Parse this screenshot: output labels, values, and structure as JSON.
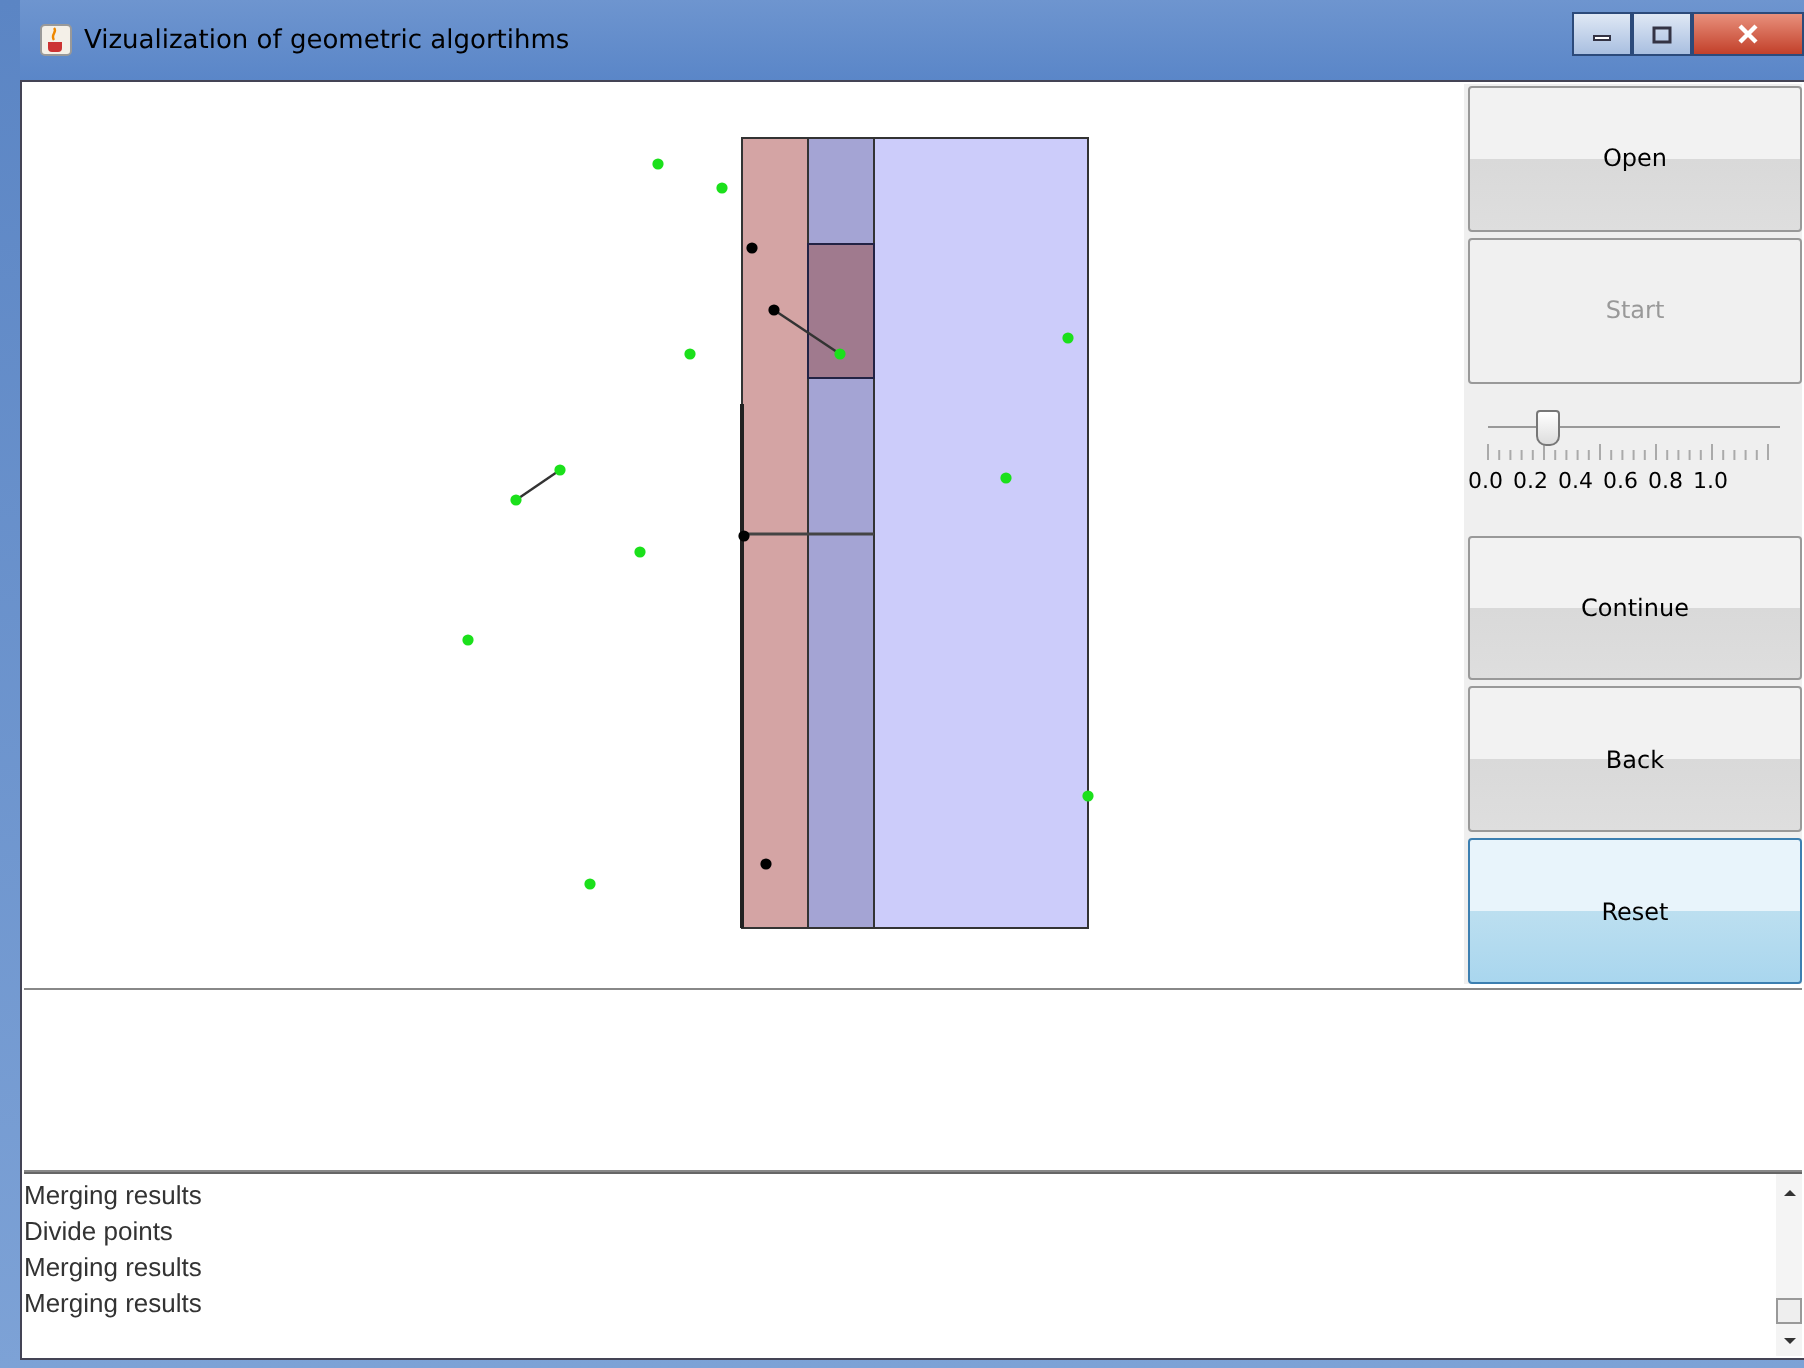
{
  "window": {
    "title": "Vizualization of geometric algortihms"
  },
  "top_buttons": [
    {
      "label": "Open",
      "disabled": false,
      "focused": false
    },
    {
      "label": "Start",
      "disabled": true,
      "focused": false
    }
  ],
  "slider": {
    "level": 0.2,
    "tick_labels": [
      "0.0",
      "0.2",
      "0.4",
      "0.6",
      "0.8",
      "1.0"
    ]
  },
  "bottom_buttons": [
    {
      "label": "Continue",
      "disabled": false,
      "focused": false
    },
    {
      "label": "Back",
      "disabled": false,
      "focused": false
    },
    {
      "label": "Reset",
      "disabled": false,
      "focused": true
    }
  ],
  "log": [
    "Merging results",
    "Divide points",
    "Merging results",
    "Merging results"
  ]
}
